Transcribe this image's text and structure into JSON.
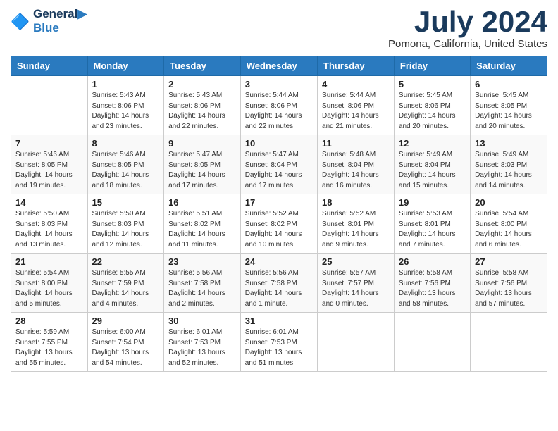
{
  "logo": {
    "line1": "General",
    "line2": "Blue"
  },
  "title": "July 2024",
  "location": "Pomona, California, United States",
  "days_of_week": [
    "Sunday",
    "Monday",
    "Tuesday",
    "Wednesday",
    "Thursday",
    "Friday",
    "Saturday"
  ],
  "weeks": [
    [
      {
        "day": "",
        "content": ""
      },
      {
        "day": "1",
        "content": "Sunrise: 5:43 AM\nSunset: 8:06 PM\nDaylight: 14 hours\nand 23 minutes."
      },
      {
        "day": "2",
        "content": "Sunrise: 5:43 AM\nSunset: 8:06 PM\nDaylight: 14 hours\nand 22 minutes."
      },
      {
        "day": "3",
        "content": "Sunrise: 5:44 AM\nSunset: 8:06 PM\nDaylight: 14 hours\nand 22 minutes."
      },
      {
        "day": "4",
        "content": "Sunrise: 5:44 AM\nSunset: 8:06 PM\nDaylight: 14 hours\nand 21 minutes."
      },
      {
        "day": "5",
        "content": "Sunrise: 5:45 AM\nSunset: 8:06 PM\nDaylight: 14 hours\nand 20 minutes."
      },
      {
        "day": "6",
        "content": "Sunrise: 5:45 AM\nSunset: 8:05 PM\nDaylight: 14 hours\nand 20 minutes."
      }
    ],
    [
      {
        "day": "7",
        "content": "Sunrise: 5:46 AM\nSunset: 8:05 PM\nDaylight: 14 hours\nand 19 minutes."
      },
      {
        "day": "8",
        "content": "Sunrise: 5:46 AM\nSunset: 8:05 PM\nDaylight: 14 hours\nand 18 minutes."
      },
      {
        "day": "9",
        "content": "Sunrise: 5:47 AM\nSunset: 8:05 PM\nDaylight: 14 hours\nand 17 minutes."
      },
      {
        "day": "10",
        "content": "Sunrise: 5:47 AM\nSunset: 8:04 PM\nDaylight: 14 hours\nand 17 minutes."
      },
      {
        "day": "11",
        "content": "Sunrise: 5:48 AM\nSunset: 8:04 PM\nDaylight: 14 hours\nand 16 minutes."
      },
      {
        "day": "12",
        "content": "Sunrise: 5:49 AM\nSunset: 8:04 PM\nDaylight: 14 hours\nand 15 minutes."
      },
      {
        "day": "13",
        "content": "Sunrise: 5:49 AM\nSunset: 8:03 PM\nDaylight: 14 hours\nand 14 minutes."
      }
    ],
    [
      {
        "day": "14",
        "content": "Sunrise: 5:50 AM\nSunset: 8:03 PM\nDaylight: 14 hours\nand 13 minutes."
      },
      {
        "day": "15",
        "content": "Sunrise: 5:50 AM\nSunset: 8:03 PM\nDaylight: 14 hours\nand 12 minutes."
      },
      {
        "day": "16",
        "content": "Sunrise: 5:51 AM\nSunset: 8:02 PM\nDaylight: 14 hours\nand 11 minutes."
      },
      {
        "day": "17",
        "content": "Sunrise: 5:52 AM\nSunset: 8:02 PM\nDaylight: 14 hours\nand 10 minutes."
      },
      {
        "day": "18",
        "content": "Sunrise: 5:52 AM\nSunset: 8:01 PM\nDaylight: 14 hours\nand 9 minutes."
      },
      {
        "day": "19",
        "content": "Sunrise: 5:53 AM\nSunset: 8:01 PM\nDaylight: 14 hours\nand 7 minutes."
      },
      {
        "day": "20",
        "content": "Sunrise: 5:54 AM\nSunset: 8:00 PM\nDaylight: 14 hours\nand 6 minutes."
      }
    ],
    [
      {
        "day": "21",
        "content": "Sunrise: 5:54 AM\nSunset: 8:00 PM\nDaylight: 14 hours\nand 5 minutes."
      },
      {
        "day": "22",
        "content": "Sunrise: 5:55 AM\nSunset: 7:59 PM\nDaylight: 14 hours\nand 4 minutes."
      },
      {
        "day": "23",
        "content": "Sunrise: 5:56 AM\nSunset: 7:58 PM\nDaylight: 14 hours\nand 2 minutes."
      },
      {
        "day": "24",
        "content": "Sunrise: 5:56 AM\nSunset: 7:58 PM\nDaylight: 14 hours\nand 1 minute."
      },
      {
        "day": "25",
        "content": "Sunrise: 5:57 AM\nSunset: 7:57 PM\nDaylight: 14 hours\nand 0 minutes."
      },
      {
        "day": "26",
        "content": "Sunrise: 5:58 AM\nSunset: 7:56 PM\nDaylight: 13 hours\nand 58 minutes."
      },
      {
        "day": "27",
        "content": "Sunrise: 5:58 AM\nSunset: 7:56 PM\nDaylight: 13 hours\nand 57 minutes."
      }
    ],
    [
      {
        "day": "28",
        "content": "Sunrise: 5:59 AM\nSunset: 7:55 PM\nDaylight: 13 hours\nand 55 minutes."
      },
      {
        "day": "29",
        "content": "Sunrise: 6:00 AM\nSunset: 7:54 PM\nDaylight: 13 hours\nand 54 minutes."
      },
      {
        "day": "30",
        "content": "Sunrise: 6:01 AM\nSunset: 7:53 PM\nDaylight: 13 hours\nand 52 minutes."
      },
      {
        "day": "31",
        "content": "Sunrise: 6:01 AM\nSunset: 7:53 PM\nDaylight: 13 hours\nand 51 minutes."
      },
      {
        "day": "",
        "content": ""
      },
      {
        "day": "",
        "content": ""
      },
      {
        "day": "",
        "content": ""
      }
    ]
  ]
}
